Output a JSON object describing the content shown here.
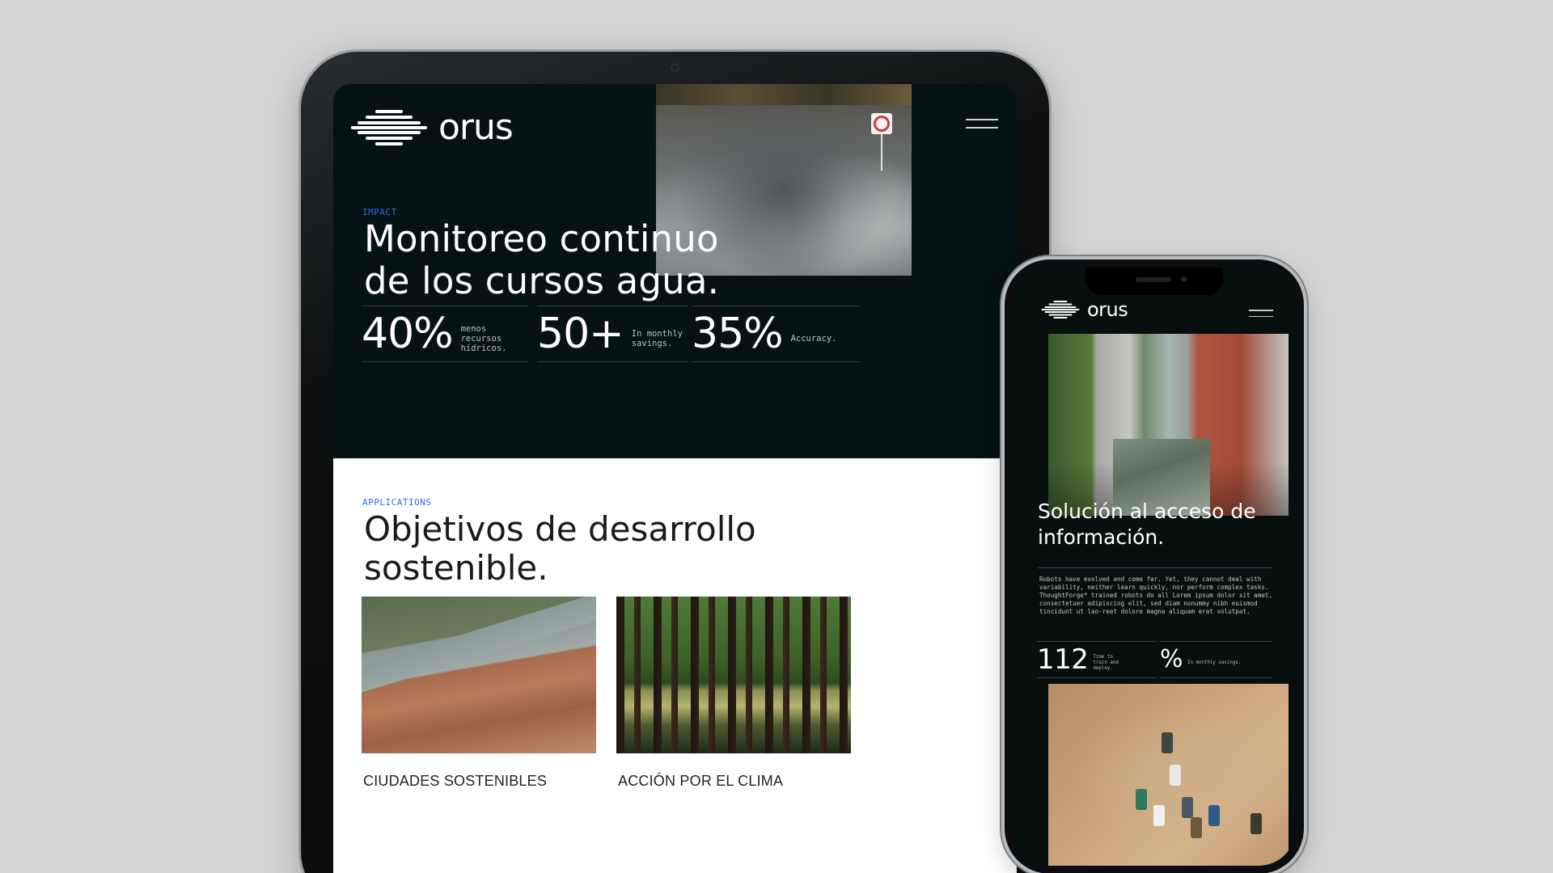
{
  "tablet": {
    "brand": "orus",
    "impact_label": "IMPACT",
    "headline": "Monitoreo continuo de los cursos agua.",
    "stats": [
      {
        "value": "40%",
        "caption": "menos recursos hídricos."
      },
      {
        "value": "50+",
        "caption": "In monthly savings."
      },
      {
        "value": "35%",
        "caption": "Accuracy."
      }
    ],
    "applications_label": "APPLICATIONS",
    "sdg_title": "Objetivos de desarrollo sostenible.",
    "cards": [
      {
        "label": "CIUDADES SOSTENIBLES"
      },
      {
        "label": "ACCIÓN POR EL CLIMA"
      }
    ]
  },
  "phone": {
    "brand": "orus",
    "headline": "Solución al acceso de información.",
    "body": "Robots have evolved and come far. Yet, they cannot deal with variability, neither learn quickly, nor perform complex tasks. ThoughtForge* trained robots do all Lorem ipsum dolor sit amet, consectetuer adipiscing elit, sed diam nonummy nibh euismod tincidunt ut lao-reet dolore magna aliquam erat volutpat.",
    "stats": [
      {
        "value": "112",
        "caption": "Time to train and deploy."
      },
      {
        "value": "%",
        "caption": "In monthly savings."
      }
    ]
  },
  "colors": {
    "dark_bg": "#071214",
    "accent_blue": "#2f6de8",
    "device_bg": "#d4d4d4"
  }
}
